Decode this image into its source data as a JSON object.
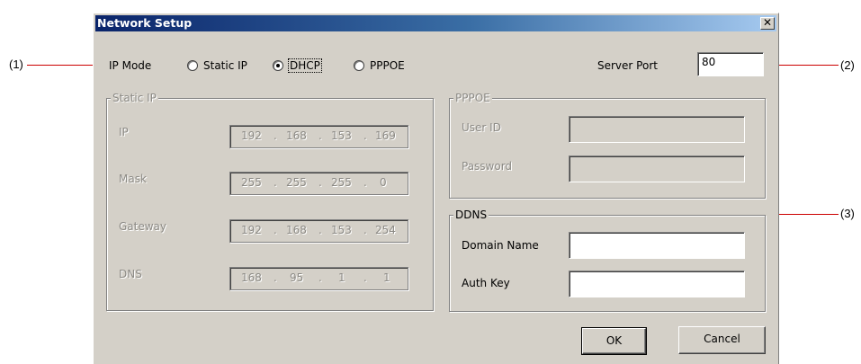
{
  "callouts": {
    "c1": "(1)",
    "c2": "(2)",
    "c3": "(3)"
  },
  "window": {
    "title": "Network Setup",
    "close_glyph": "✕"
  },
  "ip_mode": {
    "label": "IP Mode",
    "options": [
      "Static IP",
      "DHCP",
      "PPPOE"
    ],
    "selected": "DHCP"
  },
  "server_port": {
    "label": "Server Port",
    "value": "80"
  },
  "static_ip": {
    "title": "Static IP",
    "rows": [
      {
        "label": "IP",
        "octets": [
          "192",
          "168",
          "153",
          "169"
        ]
      },
      {
        "label": "Mask",
        "octets": [
          "255",
          "255",
          "255",
          "0"
        ]
      },
      {
        "label": "Gateway",
        "octets": [
          "192",
          "168",
          "153",
          "254"
        ]
      },
      {
        "label": "DNS",
        "octets": [
          "168",
          "95",
          "1",
          "1"
        ]
      }
    ]
  },
  "pppoe": {
    "title": "PPPOE",
    "user_id_label": "User ID",
    "user_id_value": "",
    "password_label": "Password",
    "password_value": ""
  },
  "ddns": {
    "title": "DDNS",
    "domain_label": "Domain Name",
    "domain_value": "",
    "auth_label": "Auth Key",
    "auth_value": ""
  },
  "buttons": {
    "ok": "OK",
    "cancel": "Cancel"
  }
}
